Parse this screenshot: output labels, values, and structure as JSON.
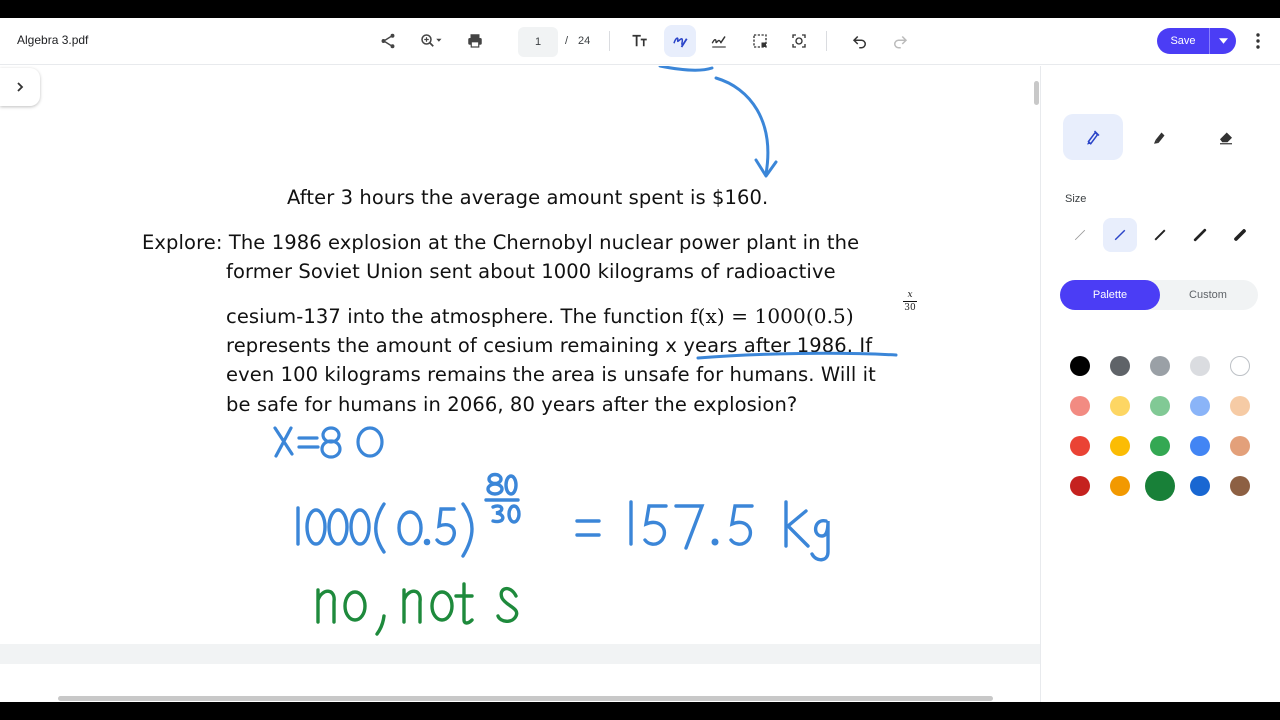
{
  "file": {
    "name": "Algebra 3.pdf"
  },
  "toolbar": {
    "page_current": "1",
    "page_separator": "/",
    "page_total": "24",
    "save_label": "Save",
    "icons": [
      "share-icon",
      "zoom-icon",
      "print-icon",
      "text-size-icon",
      "draw-icon",
      "signature-icon",
      "select-icon",
      "screenshot-icon",
      "undo-icon",
      "redo-icon",
      "more-icon"
    ]
  },
  "document": {
    "line1": "After 3 hours the average amount spent is $160.",
    "line2": "Explore: The 1986 explosion at the Chernobyl nuclear power plant in the",
    "line3": "former Soviet Union sent about 1000 kilograms of radioactive",
    "line4_text": "cesium-137 into the atmosphere. The function ",
    "line4_math": "f(x) = 1000(0.5)",
    "exp_num": "x",
    "exp_den": "30",
    "line5": "represents the amount of cesium remaining x years after 1986. If",
    "line6": "even 100 kilograms remains the area is unsafe for humans. Will it",
    "line7": "be safe for humans in 2066, 80 years after the explosion?"
  },
  "handwriting": {
    "line1": "x=80",
    "line2": "1000(0.5)",
    "line2_exp_num": "80",
    "line2_exp_den": "30",
    "line2_result": "= 157.5 Kg",
    "line3": "no, not s",
    "colors": {
      "blue": "#3b86d8",
      "green": "#1e8a3c"
    }
  },
  "panel": {
    "size_label": "Size",
    "tab_palette": "Palette",
    "tab_custom": "Custom",
    "palette": [
      [
        "#000000",
        "#5f6368",
        "#9aa0a6",
        "#dadce0",
        "#ffffff"
      ],
      [
        "#f28b82",
        "#fdd663",
        "#81c995",
        "#8ab4f8",
        "#f6cba5"
      ],
      [
        "#ea4335",
        "#fbbc04",
        "#34a853",
        "#4285f4",
        "#e3a07a"
      ],
      [
        "#c5221f",
        "#f29900",
        "#188038",
        "#1967d2",
        "#8d6043"
      ]
    ],
    "selected_color": "#188038"
  },
  "accent_color": "#4b3df5"
}
